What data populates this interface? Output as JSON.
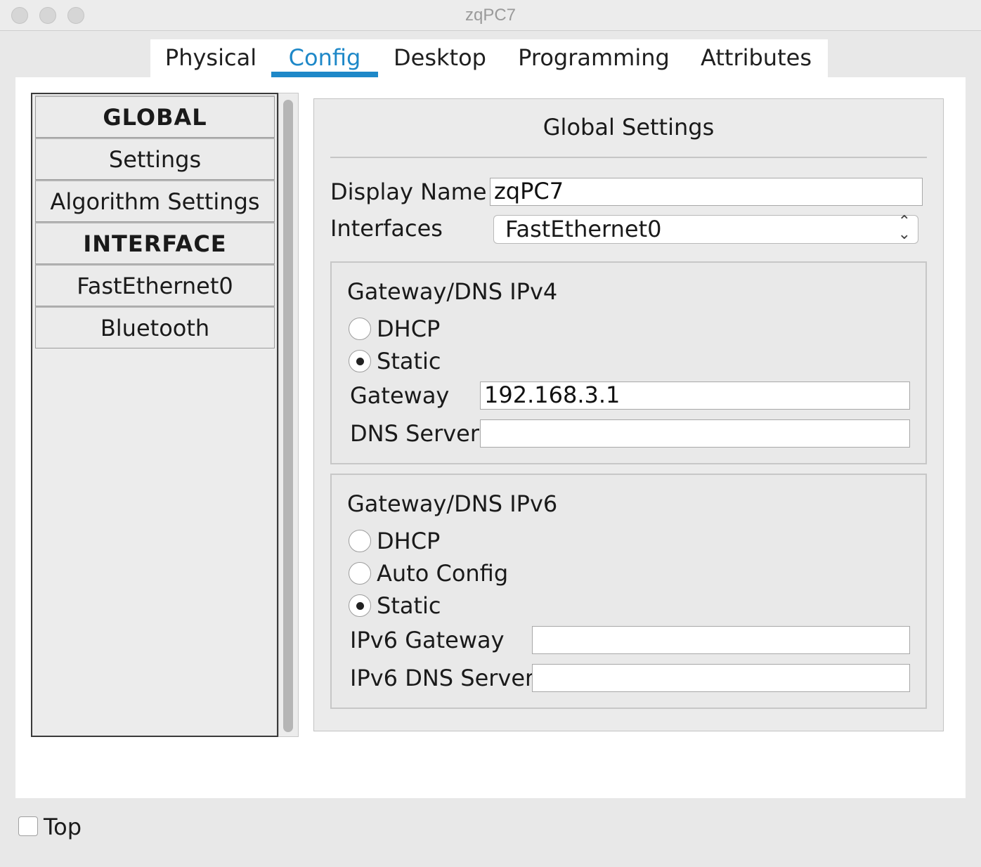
{
  "window": {
    "title": "zqPC7"
  },
  "tabs": [
    {
      "label": "Physical"
    },
    {
      "label": "Config"
    },
    {
      "label": "Desktop"
    },
    {
      "label": "Programming"
    },
    {
      "label": "Attributes"
    }
  ],
  "active_tab": "Config",
  "nav": {
    "global_header": "GLOBAL",
    "settings": "Settings",
    "algorithm_settings": "Algorithm Settings",
    "interface_header": "INTERFACE",
    "fastethernet0": "FastEthernet0",
    "bluetooth": "Bluetooth"
  },
  "panel": {
    "title": "Global Settings",
    "display_name_label": "Display Name",
    "display_name_value": "zqPC7",
    "interfaces_label": "Interfaces",
    "interfaces_selected": "FastEthernet0"
  },
  "ipv4": {
    "title": "Gateway/DNS IPv4",
    "dhcp_label": "DHCP",
    "static_label": "Static",
    "selected": "Static",
    "gateway_label": "Gateway",
    "gateway_value": "192.168.3.1",
    "dns_label": "DNS Server",
    "dns_value": ""
  },
  "ipv6": {
    "title": "Gateway/DNS IPv6",
    "dhcp_label": "DHCP",
    "auto_label": "Auto Config",
    "static_label": "Static",
    "selected": "Static",
    "gateway_label": "IPv6 Gateway",
    "gateway_value": "",
    "dns_label": "IPv6 DNS Server",
    "dns_value": ""
  },
  "footer": {
    "top_label": "Top",
    "top_checked": false
  },
  "colors": {
    "accent": "#1e88c8"
  }
}
